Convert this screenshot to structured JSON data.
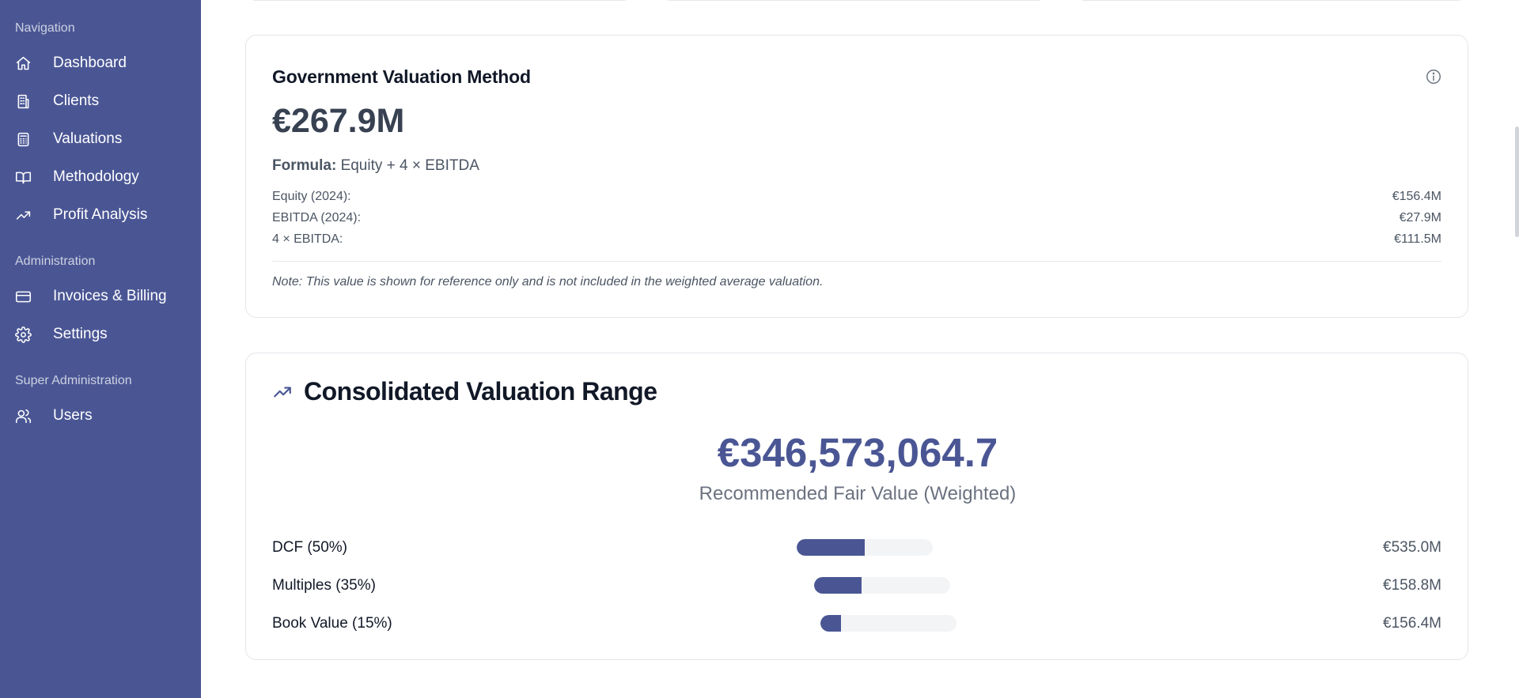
{
  "sidebar": {
    "sections": [
      {
        "label": "Navigation"
      },
      {
        "label": "Administration"
      },
      {
        "label": "Super Administration"
      }
    ],
    "items": [
      {
        "label": "Dashboard",
        "icon": "home-icon"
      },
      {
        "label": "Clients",
        "icon": "building-icon"
      },
      {
        "label": "Valuations",
        "icon": "calculator-icon"
      },
      {
        "label": "Methodology",
        "icon": "book-icon"
      },
      {
        "label": "Profit Analysis",
        "icon": "trending-up-icon"
      },
      {
        "label": "Invoices & Billing",
        "icon": "credit-card-icon"
      },
      {
        "label": "Settings",
        "icon": "gear-icon"
      },
      {
        "label": "Users",
        "icon": "users-icon"
      }
    ]
  },
  "government": {
    "title": "Government Valuation Method",
    "value": "€267.9M",
    "formula_label": "Formula:",
    "formula": "Equity + 4 × EBITDA",
    "rows": [
      {
        "label": "Equity (2024):",
        "value": "€156.4M"
      },
      {
        "label": "EBITDA (2024):",
        "value": "€27.9M"
      },
      {
        "label": "4 × EBITDA:",
        "value": "€111.5M"
      }
    ],
    "note": "Note: This value is shown for reference only and is not included in the weighted average valuation."
  },
  "consolidated": {
    "title": "Consolidated Valuation Range",
    "value": "€346,573,064.7",
    "subtitle": "Recommended Fair Value (Weighted)",
    "methods": [
      {
        "label": "DCF (50%)",
        "value": "€535.0M",
        "fill": 0.5
      },
      {
        "label": "Multiples (35%)",
        "value": "€158.8M",
        "fill": 0.35
      },
      {
        "label": "Book Value (15%)",
        "value": "€156.4M",
        "fill": 0.15
      }
    ]
  },
  "colors": {
    "sidebar": "#4a5694",
    "accent": "#4a5694",
    "track": "#f3f4f6"
  }
}
